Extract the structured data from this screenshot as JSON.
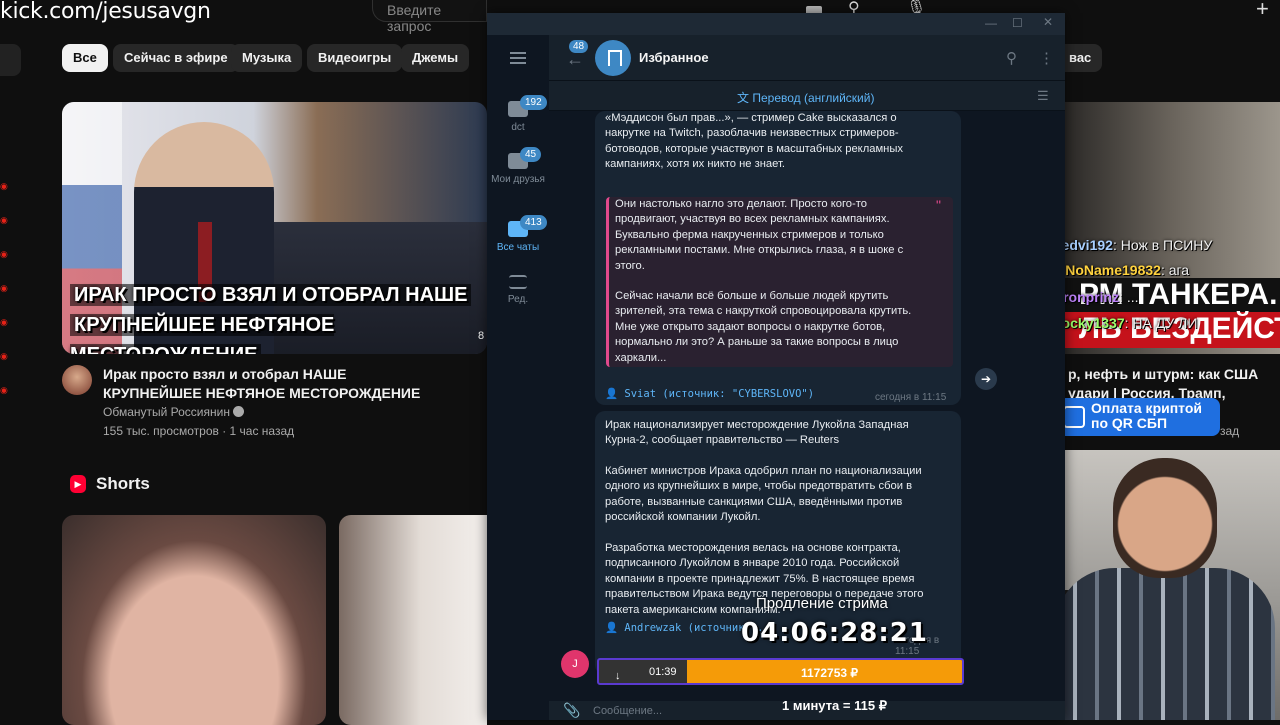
{
  "browser": {
    "url": "kick.com/jesusavgn",
    "search_placeholder": "Введите запрос"
  },
  "youtube": {
    "chips": [
      "Все",
      "Сейчас в эфире",
      "Музыка",
      "Видеоигры",
      "Джемы"
    ],
    "chip_partial_right": "вас",
    "main_video": {
      "thumb_caption_1": "ИРАК ПРОСТО ВЗЯЛ И ОТОБРАЛ НАШЕ",
      "thumb_caption_2": "КРУПНЕЙШЕЕ НЕФТЯНОЕ МЕСТОРОЖДЕНИЕ",
      "duration_partial": "8",
      "title": "Ирак просто взял и отобрал НАШЕ КРУПНЕЙШЕЕ НЕФТЯНОЕ МЕСТОРОЖДЕНИЕ",
      "channel": "Обманутый Россиянин",
      "meta": "155 тыс. просмотров · 1 час назад"
    },
    "shorts_label": "Shorts",
    "right_video": {
      "banner_1": "РМ ТАНКЕРА.",
      "banner_2": "ЛЬ БЕЗДЕЙСТВ",
      "title": "р, нефть и штурм: как США удари | Россия, Трамп, Венесуэла",
      "meta_partial": "зад"
    }
  },
  "stream_chat": [
    {
      "user": "dedvi192",
      "text": ": Нож в ПСИНУ",
      "color": "#a9d0ff"
    },
    {
      "user": "NoName19832",
      "text": ": ага",
      "color": "#ffd23f"
    },
    {
      "user": "Kronprinz",
      "text": ": ...",
      "color": "#c084fc"
    },
    {
      "user": "flocky1337",
      "text": ": НА ДУ ЛИ",
      "color": "#9cff6b"
    }
  ],
  "qr_pay": {
    "line1": "Оплата криптой",
    "line2": "по QR СБП"
  },
  "telegram": {
    "folders": [
      {
        "label": "dct",
        "badge": "192"
      },
      {
        "label": "Мои друзья",
        "badge": "45"
      },
      {
        "label": "Все чаты",
        "badge": "413"
      },
      {
        "label": "Ред.",
        "badge": ""
      }
    ],
    "back_badge": "48",
    "chat_title": "Избранное",
    "translate_label": "Перевод (английский)",
    "msg1": {
      "text": "«Мэддисон был прав...», — стример Cake высказался о накрутке на Twitch, разоблачив неизвестных стримеров-ботоводов, которые участвуют в масштабных рекламных кампаниях, хотя их никто не знает.",
      "quote_p1": "Они настолько нагло это делают. Просто кого-то продвигают, участвуя во всех рекламных кампаниях. Буквально ферма накрученных стримеров и только рекламными постами. Мне открылись глаза, я в шоке с этого.",
      "quote_p2": "Сейчас начали всё больше и больше людей крутить зрителей, эта тема с накруткой спровоцировала крутить. Мне уже открыто задают вопросы о накрутке ботов, нормально ли это? А раньше за такие вопросы в лицо харкали...",
      "source": "Sviat (источник: \"CYBERSLOVO\")",
      "time": "сегодня в 11:15"
    },
    "msg2": {
      "p1": "Ирак национализирует месторождение Лукойла Западная Курна-2, сообщает правительство — Reuters",
      "p2": "Кабинет министров Ирака одобрил план по национализации одного из крупнейших в мире, чтобы предотвратить сбои в работе, вызванные санкциями США, введёнными против российской компании Лукойл.",
      "p3": "Разработка месторождения велась на основе контракта, подписанного Лукойлом в январе 2010 года. Российской компании в проекте принадлежит 75%. В настоящее время правительством Ирака ведутся переговоры о передаче этого пакета американским компаниям.",
      "source": "Andrewzak (источник: ...",
      "time": "сегодня в 11:15"
    },
    "avatar_letter": "J",
    "composer_placeholder": "Сообщение..."
  },
  "overlay": {
    "extension_label": "Продление стрима",
    "timer": "04:06:28:21",
    "donation_time": "01:39",
    "donation_amount": "1172753 ₽",
    "rate": "1 минута = 115 ₽"
  }
}
